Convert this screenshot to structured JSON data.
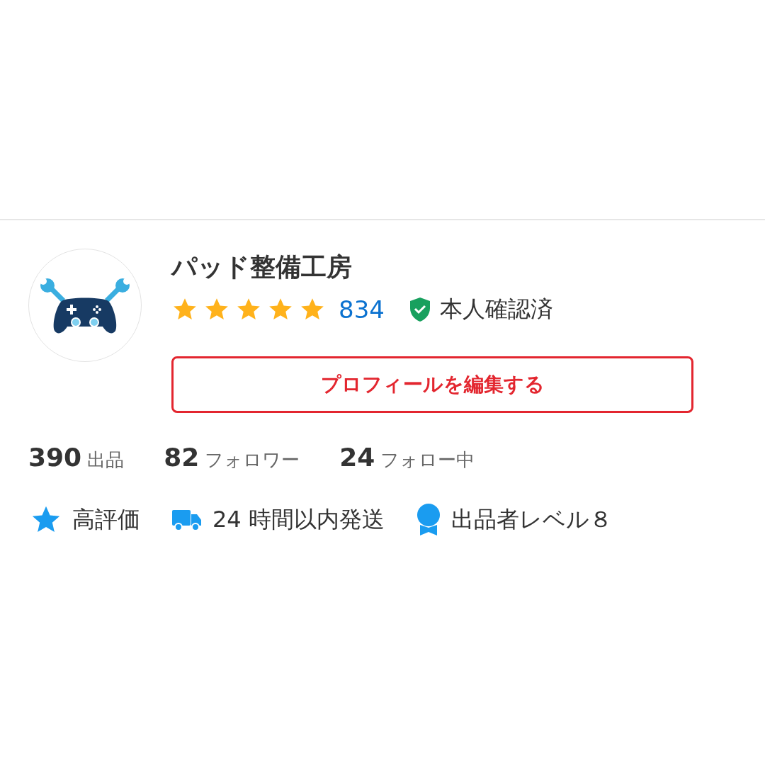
{
  "profile": {
    "name": "パッド整備工房",
    "stars": 5,
    "review_count": "834",
    "verified_label": "本人確認済",
    "edit_button": "プロフィールを編集する"
  },
  "stats": [
    {
      "value": "390",
      "label": "出品"
    },
    {
      "value": "82",
      "label": "フォロワー"
    },
    {
      "value": "24",
      "label": "フォロー中"
    }
  ],
  "badges": [
    {
      "kind": "star",
      "label": "高評価"
    },
    {
      "kind": "truck",
      "label": "24 時間以内発送"
    },
    {
      "kind": "ribbon",
      "label": "出品者レベル８"
    }
  ]
}
